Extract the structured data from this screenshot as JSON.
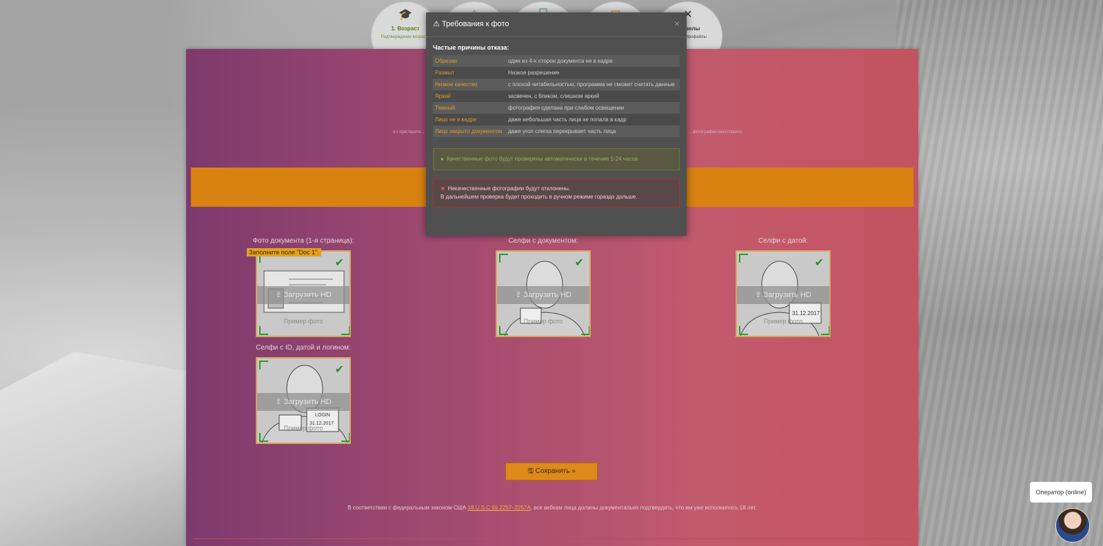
{
  "steps": [
    {
      "title": "1. Возраст",
      "subtitle": "Подтверждение возраста",
      "icon": "graduation-cap-icon"
    },
    {
      "title": "",
      "subtitle": "",
      "icon": "home-icon"
    },
    {
      "title": "",
      "subtitle": "",
      "icon": "shield-icon"
    },
    {
      "title": "",
      "subtitle": "",
      "icon": "id-card-icon"
    },
    {
      "title": "...ювелы",
      "subtitle": "...обные профайлы",
      "icon": "tools-icon"
    }
  ],
  "panel": {
    "tiny_text_left": "и к пригласите...",
    "tiny_text_right": "...фотографии качественно."
  },
  "uploads": [
    {
      "label": "Фото документа (1-я страница):",
      "button": "Загрузить HD",
      "sample": "Пример фото",
      "tooltip": "Заполните поле \"Doc 1\"."
    },
    {
      "label": "Селфи с документом:",
      "button": "Загрузить HD",
      "sample": "Пример фото"
    },
    {
      "label": "Селфи с датой:",
      "button": "Загрузить HD",
      "sample": "Пример фото"
    },
    {
      "label": "Селфи с ID, датой и логином:",
      "button": "Загрузить HD",
      "sample": "Пример фото"
    }
  ],
  "save": {
    "label": "Сохранить »"
  },
  "law": {
    "before": "В соответствии с федеральным законом США ",
    "link": "18 U.S.C §§ 2257–2257A",
    "after": ", все вебкам лица должны документально подтвердить, что им уже исполнилось 18 лет."
  },
  "modal": {
    "title": "Требования к фото",
    "close": "×",
    "subtitle": "Частые причины отказа:",
    "reasons": [
      {
        "key": "Обрезан",
        "value": "один из 4-х сторон документа не в кадре"
      },
      {
        "key": "Размыт",
        "value": "Низкое разрешение"
      },
      {
        "key": "Низкое качество",
        "value": "с плохой читабельностью, программа не сможет считать данные"
      },
      {
        "key": "Яркий",
        "value": "засвечен, с бликом, слишком яркий"
      },
      {
        "key": "Темный",
        "value": "фотография сделана при слабом освещении"
      },
      {
        "key": "Лицо не в кадре",
        "value": "даже небольшая часть лица не попала в кадр"
      },
      {
        "key": "Лицо закрыто документом",
        "value": "даже угол слегка перекрывает часть лица"
      }
    ],
    "ok_text": "Качественные фото будут проверены автоматически в течение 1-24 часов.",
    "bad_line1": "Некачественные фотографии будут отклонены.",
    "bad_line2": "В дальнейшем проверка будет проходить в ручном режиме гораздо дольше."
  },
  "operator": {
    "label": "Оператор (online)"
  },
  "card_sample_texts": {
    "login": "LOGIN",
    "date": "31.12.2017"
  }
}
